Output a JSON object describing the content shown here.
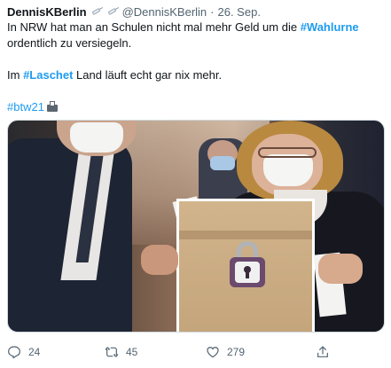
{
  "tweet": {
    "author_name": "DennisKBerlin",
    "handle": "@DennisKBerlin",
    "separator": "·",
    "date": "26. Sep.",
    "body": {
      "line1_prefix": "In NRW hat man an Schulen nicht mal mehr Geld um die ",
      "line1_hashtag": "#Wahlurne",
      "line1_suffix": " ordentlich zu versiegeln.",
      "line2_prefix": "Im ",
      "line2_hashtag": "#Laschet",
      "line2_suffix": " Land läuft echt gar nix mehr.",
      "line3_hashtag": "#btw21"
    },
    "icons": {
      "name_decoration": "syringe-icon",
      "hashtag_decoration": "ballot-box-flag-icon"
    },
    "image_description": "Two masked people at a ballot box sealed with a small padlock",
    "actions": {
      "reply_count": "24",
      "retweet_count": "45",
      "like_count": "279"
    },
    "colors": {
      "link": "#1d9bf0",
      "text": "#0f1419",
      "muted": "#536471"
    }
  }
}
